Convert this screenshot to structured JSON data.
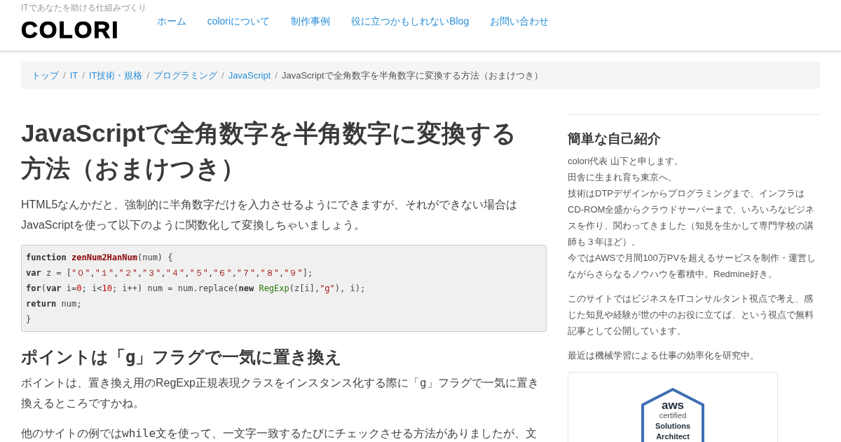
{
  "header": {
    "tagline": "ITであなたを助ける仕組みづくり",
    "logo": "COLORI",
    "nav": [
      "ホーム",
      "coloriについて",
      "制作事例",
      "役に立つかもしれないBlog",
      "お問い合わせ"
    ]
  },
  "breadcrumb": {
    "links": [
      "トップ",
      "IT",
      "IT技術・規格",
      "プログラミング",
      "JavaScript"
    ],
    "separator": "/",
    "current": "JavaScriptで全角数字を半角数字に変換する方法（おまけつき）"
  },
  "article": {
    "title": "JavaScriptで全角数字を半角数字に変換する方法（おまけつき）",
    "intro": "HTML5なんかだと、強制的に半角数字だけを入力させるようにできますが、それができない場合はJavaScriptを使って以下のように関数化して変換しちゃいましょう。",
    "code": [
      [
        {
          "kind": "keyword",
          "text": "function "
        },
        {
          "kind": "name",
          "text": "zenNum2HanNum"
        },
        {
          "kind": "plain",
          "text": "(num) {"
        }
      ],
      [
        {
          "kind": "keyword",
          "text": "var"
        },
        {
          "kind": "plain",
          "text": " z = ["
        },
        {
          "kind": "string",
          "text": "\"０\""
        },
        {
          "kind": "plain",
          "text": ","
        },
        {
          "kind": "string",
          "text": "\"１\""
        },
        {
          "kind": "plain",
          "text": ","
        },
        {
          "kind": "string",
          "text": "\"２\""
        },
        {
          "kind": "plain",
          "text": ","
        },
        {
          "kind": "string",
          "text": "\"３\""
        },
        {
          "kind": "plain",
          "text": ","
        },
        {
          "kind": "string",
          "text": "\"４\""
        },
        {
          "kind": "plain",
          "text": ","
        },
        {
          "kind": "string",
          "text": "\"５\""
        },
        {
          "kind": "plain",
          "text": ","
        },
        {
          "kind": "string",
          "text": "\"６\""
        },
        {
          "kind": "plain",
          "text": ","
        },
        {
          "kind": "string",
          "text": "\"７\""
        },
        {
          "kind": "plain",
          "text": ","
        },
        {
          "kind": "string",
          "text": "\"８\""
        },
        {
          "kind": "plain",
          "text": ","
        },
        {
          "kind": "string",
          "text": "\"９\""
        },
        {
          "kind": "plain",
          "text": "];"
        }
      ],
      [
        {
          "kind": "keyword",
          "text": "for"
        },
        {
          "kind": "plain",
          "text": "("
        },
        {
          "kind": "keyword",
          "text": "var"
        },
        {
          "kind": "plain",
          "text": " i="
        },
        {
          "kind": "number",
          "text": "0"
        },
        {
          "kind": "plain",
          "text": "; i<"
        },
        {
          "kind": "number",
          "text": "10"
        },
        {
          "kind": "plain",
          "text": "; i++) num = num.replace("
        },
        {
          "kind": "keyword",
          "text": "new "
        },
        {
          "kind": "class",
          "text": "RegExp"
        },
        {
          "kind": "plain",
          "text": "(z[i],"
        },
        {
          "kind": "string",
          "text": "\"g\""
        },
        {
          "kind": "plain",
          "text": "), i);"
        }
      ],
      [
        {
          "kind": "keyword",
          "text": "return"
        },
        {
          "kind": "plain",
          "text": " num;"
        }
      ],
      [
        {
          "kind": "plain",
          "text": "}"
        }
      ]
    ],
    "heading": [
      {
        "kind": "text",
        "text": "ポイントは「"
      },
      {
        "kind": "code",
        "text": "g"
      },
      {
        "kind": "text",
        "text": "」フラグで一気に置き換え"
      }
    ],
    "paragraphs": [
      [
        {
          "kind": "text",
          "text": "ポイントは、置き換え用のRegExp正規表現クラスをインスタンス化する際に「"
        },
        {
          "kind": "code",
          "text": "g"
        },
        {
          "kind": "text",
          "text": "」フラグで一気に置き換えるところですかね。"
        }
      ],
      [
        {
          "kind": "text",
          "text": "他のサイトの例では"
        },
        {
          "kind": "code",
          "text": "while"
        },
        {
          "kind": "text",
          "text": "文を使って、一文字一致するたびにチェックさせる方法がありましたが、文"
        }
      ]
    ]
  },
  "sidebar": {
    "title": "簡単な自己紹介",
    "paragraphs": [
      [
        "colori代表 山下と申します。",
        "田舎に生まれ育ち東京へ。",
        "技術はDTPデザインからプログラミングまで、インフラはCD-ROM全盛からクラウドサーバーまで、いろいろなビジネスを作り、関わってきました（知見を生かして専門学校の講師も３年ほど）。",
        "今ではAWSで月間100万PVを超えるサービスを制作・運営しながらさらなるノウハウを蓄積中。Redmine好き。"
      ],
      [
        "このサイトではビジネスをITコンサルタント視点で考え、感じた知見や経験が世の中のお役に立てば、という視点で無料記事として公開しています。"
      ],
      [
        "最近は機械学習による仕事の効率化を研究中。"
      ]
    ],
    "badge": {
      "brand": "aws",
      "lines": [
        "certified",
        "Solutions",
        "Architect"
      ]
    }
  }
}
